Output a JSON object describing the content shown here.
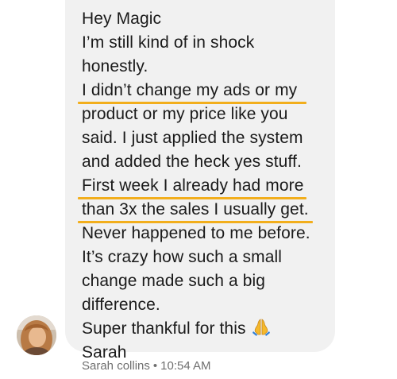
{
  "message": {
    "lines": [
      {
        "text": "Hey Magic",
        "highlight": false
      },
      {
        "text": "I’m still kind of in shock",
        "highlight": false
      },
      {
        "text": "honestly.",
        "highlight": false
      },
      {
        "text": "I didn’t change my ads or my",
        "highlight": true
      },
      {
        "text": "product or my price like you",
        "highlight": false
      },
      {
        "text": "said. I just applied the system",
        "highlight": false
      },
      {
        "text": "and added the heck yes stuff.",
        "highlight": false
      },
      {
        "text": "First week I already had more",
        "highlight": true
      },
      {
        "text": "than 3x the sales I usually get.",
        "highlight": true
      },
      {
        "text": "Never happened to me before.",
        "highlight": false
      },
      {
        "text": "It’s crazy how such a small",
        "highlight": false
      },
      {
        "text": "change made such a big",
        "highlight": false
      },
      {
        "text": "difference.",
        "highlight": false
      },
      {
        "text": "Super thankful for this",
        "highlight": false,
        "emoji": "praying-hands-icon"
      },
      {
        "text": "Sarah",
        "highlight": false
      }
    ],
    "highlight_color": "#f2ae1c",
    "bubble_color": "#f1f1f1"
  },
  "sender": {
    "name": "Sarah collins",
    "separator": "•",
    "time": "10:54 AM"
  }
}
